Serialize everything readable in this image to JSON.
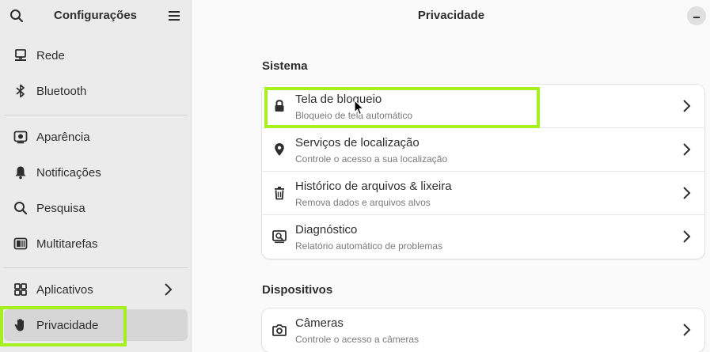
{
  "sidebar": {
    "title": "Configurações",
    "items": [
      {
        "label": "Rede",
        "icon": "network-icon"
      },
      {
        "label": "Bluetooth",
        "icon": "bluetooth-icon"
      },
      {
        "label": "Aparência",
        "icon": "appearance-icon"
      },
      {
        "label": "Notificações",
        "icon": "bell-icon"
      },
      {
        "label": "Pesquisa",
        "icon": "search-icon"
      },
      {
        "label": "Multitarefas",
        "icon": "multitasking-icon"
      },
      {
        "label": "Aplicativos",
        "icon": "apps-grid-icon"
      },
      {
        "label": "Privacidade",
        "icon": "hand-icon"
      }
    ]
  },
  "main": {
    "title": "Privacidade",
    "sections": [
      {
        "title": "Sistema",
        "rows": [
          {
            "title": "Tela de bloqueio",
            "subtitle": "Bloqueio de tela automático",
            "icon": "lock-icon"
          },
          {
            "title": "Serviços de localização",
            "subtitle": "Controle o acesso a sua localização",
            "icon": "location-pin-icon"
          },
          {
            "title": "Histórico de arquivos & lixeira",
            "subtitle": "Remova dados e arquivos alvos",
            "icon": "trash-icon"
          },
          {
            "title": "Diagnóstico",
            "subtitle": "Relatório automático de problemas",
            "icon": "diagnostics-icon"
          }
        ]
      },
      {
        "title": "Dispositivos",
        "rows": [
          {
            "title": "Câmeras",
            "subtitle": "Controle o acesso a câmeras",
            "icon": "camera-icon"
          }
        ]
      }
    ]
  },
  "colors": {
    "highlight": "#a6f01e",
    "sidebar_bg": "#ebebeb",
    "active_item_bg": "#d6d6d6",
    "content_bg": "#fafafa"
  }
}
